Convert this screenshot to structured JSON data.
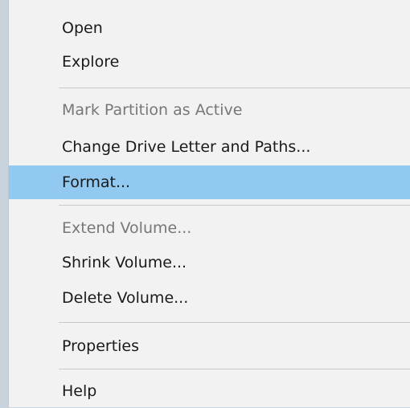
{
  "context_menu": {
    "items": [
      {
        "label": "Open",
        "state": "enabled"
      },
      {
        "label": "Explore",
        "state": "enabled"
      },
      {
        "label": "Mark Partition as Active",
        "state": "disabled"
      },
      {
        "label": "Change Drive Letter and Paths...",
        "state": "enabled"
      },
      {
        "label": "Format...",
        "state": "highlighted"
      },
      {
        "label": "Extend Volume...",
        "state": "disabled"
      },
      {
        "label": "Shrink Volume...",
        "state": "enabled"
      },
      {
        "label": "Delete Volume...",
        "state": "enabled"
      },
      {
        "label": "Properties",
        "state": "enabled"
      },
      {
        "label": "Help",
        "state": "enabled"
      }
    ]
  },
  "colors": {
    "menu_background": "#f2f2f2",
    "highlight": "#91c9f0",
    "disabled_text": "#777777",
    "text": "#1a1a1a",
    "separator": "#c8c8c8",
    "backdrop": "#c9d3dc"
  }
}
